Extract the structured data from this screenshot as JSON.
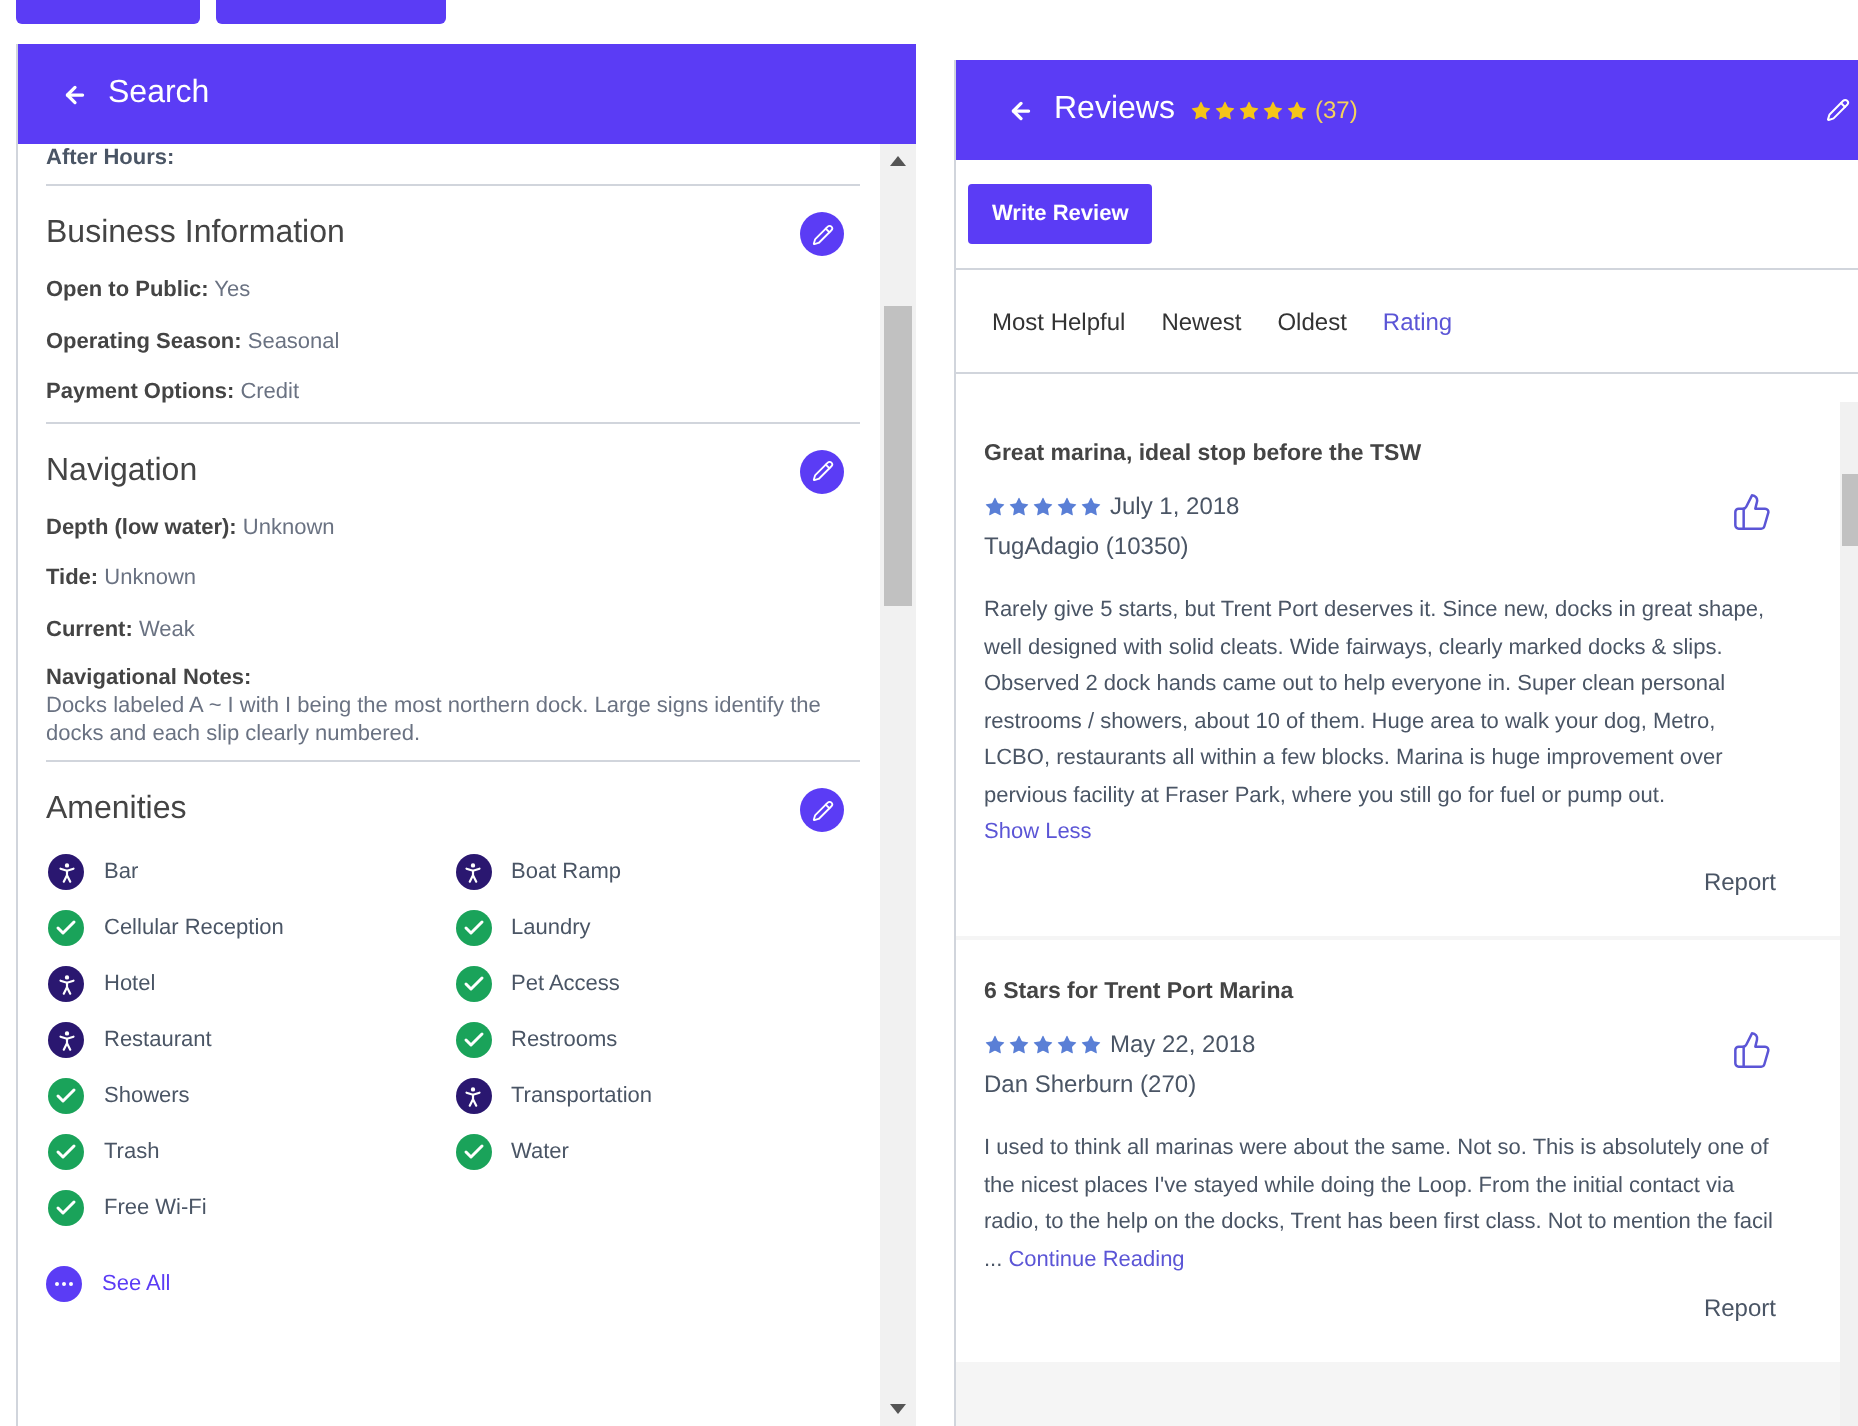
{
  "left_panel": {
    "back_label": "Search",
    "cut_field": "After Hours:",
    "sections": [
      {
        "title": "Business Information",
        "fields": [
          {
            "label": "Open to Public:",
            "value": "Yes"
          },
          {
            "label": "Operating Season:",
            "value": "Seasonal"
          },
          {
            "label": "Payment Options:",
            "value": "Credit"
          }
        ]
      },
      {
        "title": "Navigation",
        "fields": [
          {
            "label": "Depth (low water):",
            "value": "Unknown"
          },
          {
            "label": "Tide:",
            "value": "Unknown"
          },
          {
            "label": "Current:",
            "value": "Weak"
          }
        ],
        "notes_label": "Navigational Notes:",
        "notes": "Docks labeled A ~ I with I being the most northern dock.  Large signs identify the docks and each slip clearly numbered."
      }
    ],
    "amenities": {
      "title": "Amenities",
      "items": [
        {
          "label": "Bar",
          "kind": "info"
        },
        {
          "label": "Boat Ramp",
          "kind": "info"
        },
        {
          "label": "Cellular Reception",
          "kind": "available"
        },
        {
          "label": "Laundry",
          "kind": "available"
        },
        {
          "label": "Hotel",
          "kind": "info"
        },
        {
          "label": "Pet Access",
          "kind": "available"
        },
        {
          "label": "Restaurant",
          "kind": "info"
        },
        {
          "label": "Restrooms",
          "kind": "available"
        },
        {
          "label": "Showers",
          "kind": "available"
        },
        {
          "label": "Transportation",
          "kind": "info"
        },
        {
          "label": "Trash",
          "kind": "available"
        },
        {
          "label": "Water",
          "kind": "available"
        },
        {
          "label": "Free Wi-Fi",
          "kind": "available"
        }
      ],
      "see_all": "See All"
    }
  },
  "right_panel": {
    "title": "Reviews",
    "stars": 5,
    "count": "(37)",
    "write_button": "Write Review",
    "sort_tabs": [
      {
        "label": "Most Helpful",
        "selected": false
      },
      {
        "label": "Newest",
        "selected": false
      },
      {
        "label": "Oldest",
        "selected": false
      },
      {
        "label": "Rating",
        "selected": true
      }
    ],
    "reviews": [
      {
        "title": "Great marina, ideal stop before the TSW",
        "stars": 5,
        "date": "July 1, 2018",
        "author": "TugAdagio (10350)",
        "body": "Rarely give 5 starts, but Trent Port deserves it.  Since new, docks in great shape, well designed with solid cleats.  Wide fairways, clearly marked docks & slips.  Observed 2 dock hands came out to help everyone in.  Super clean personal restrooms / showers, about 10 of them.  Huge area to walk your dog, Metro, LCBO, restaurants all within a few blocks.  Marina is huge improvement over pervious facility at Fraser Park, where you still go for fuel or pump out.",
        "link": "Show Less",
        "report": "Report"
      },
      {
        "title": "6 Stars for Trent Port Marina",
        "stars": 5,
        "date": "May 22, 2018",
        "author": "Dan Sherburn (270)",
        "body": "I used to think all marinas were about the same. Not so. This is absolutely one of the nicest places I've stayed while doing the Loop. From the initial contact via radio, to the help on the docks, Trent  has been first class. Not to mention the facil ...",
        "link": "Continue Reading",
        "report": "Report"
      }
    ]
  }
}
